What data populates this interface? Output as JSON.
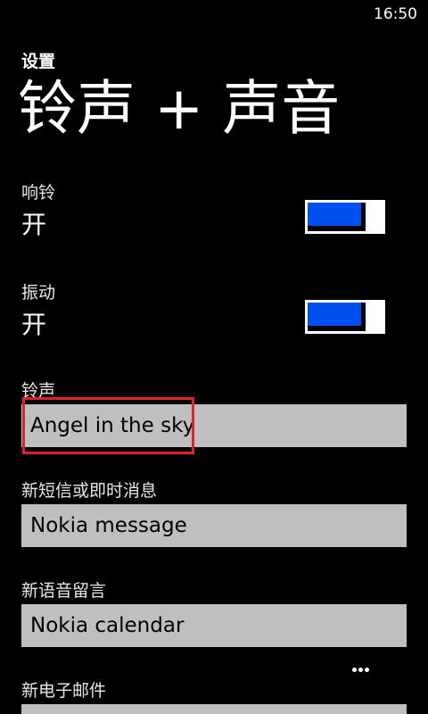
{
  "status_bar": {
    "time": "16:50"
  },
  "header": {
    "breadcrumb": "设置",
    "title": "铃声 + 声音"
  },
  "ringer": {
    "label": "响铃",
    "value": "开",
    "on": true
  },
  "vibrate": {
    "label": "振动",
    "value": "开",
    "on": true
  },
  "ringtone": {
    "label": "铃声",
    "value": "Angel in the sky"
  },
  "new_message": {
    "label": "新短信或即时消息",
    "value": "Nokia message"
  },
  "new_voicemail": {
    "label": "新语音留言",
    "value": "Nokia calendar"
  },
  "new_email": {
    "label": "新电子邮件"
  },
  "colors": {
    "accent": "#0050ef",
    "field_bg": "#bfbfbf",
    "highlight": "#e0202a"
  }
}
